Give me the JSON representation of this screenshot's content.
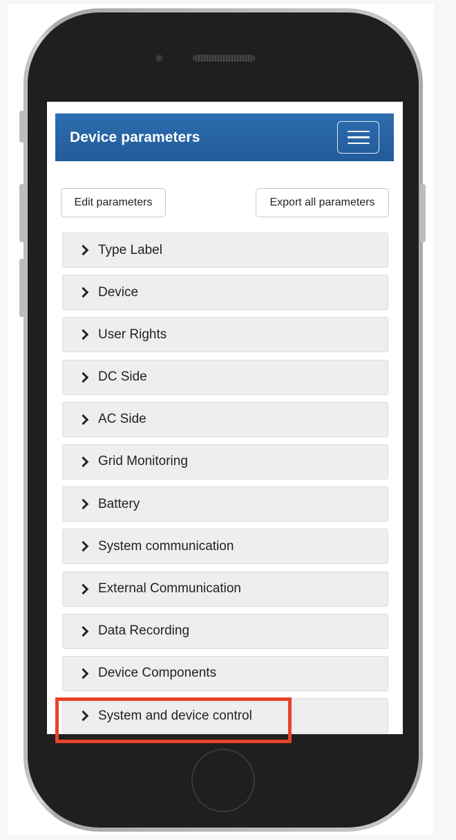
{
  "header": {
    "title": "Device parameters"
  },
  "toolbar": {
    "edit_label": "Edit parameters",
    "export_label": "Export all parameters"
  },
  "sections": [
    {
      "label": "Type Label"
    },
    {
      "label": "Device"
    },
    {
      "label": "User Rights"
    },
    {
      "label": "DC Side"
    },
    {
      "label": "AC Side"
    },
    {
      "label": "Grid Monitoring"
    },
    {
      "label": "Battery"
    },
    {
      "label": "System communication"
    },
    {
      "label": "External Communication"
    },
    {
      "label": "Data Recording"
    },
    {
      "label": "Device Components"
    },
    {
      "label": "System and device control"
    }
  ],
  "colors": {
    "navbar": "#2366a6",
    "highlight": "#e8432b",
    "section_bg": "#eeeeee"
  },
  "icons": {
    "menu": "hamburger-menu-icon",
    "section": "chevron-right-icon"
  }
}
